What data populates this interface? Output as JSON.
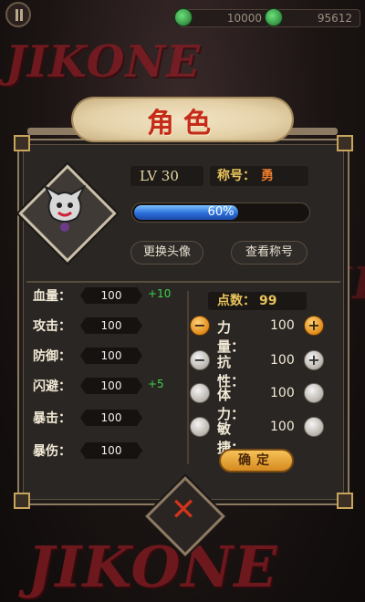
{
  "top": {
    "resource1": "10000",
    "resource2": "95612"
  },
  "panel": {
    "title": "角色",
    "level": "LV 30",
    "title_label": "称号：",
    "title_value": "勇",
    "exp_percent": 60,
    "exp_text": "60%",
    "change_avatar": "更换头像",
    "view_titles": "查看称号"
  },
  "stats": [
    {
      "label": "血量：",
      "value": "100",
      "bonus": "+10"
    },
    {
      "label": "攻击：",
      "value": "100",
      "bonus": ""
    },
    {
      "label": "防御：",
      "value": "100",
      "bonus": ""
    },
    {
      "label": "闪避：",
      "value": "100",
      "bonus": "+5"
    },
    {
      "label": "暴击：",
      "value": "100",
      "bonus": ""
    },
    {
      "label": "暴伤：",
      "value": "100",
      "bonus": ""
    }
  ],
  "points": {
    "label": "点数：",
    "value": "99"
  },
  "alloc": [
    {
      "label": "力量：",
      "value": "100"
    },
    {
      "label": "抗性：",
      "value": "100"
    },
    {
      "label": "体力：",
      "value": "100"
    },
    {
      "label": "敏捷：",
      "value": "100"
    }
  ],
  "confirm": "确定",
  "watermark": "JIKONE",
  "colors": {
    "accent": "#e9c35b",
    "bonus": "#3bd24a",
    "close": "#d3331a"
  }
}
